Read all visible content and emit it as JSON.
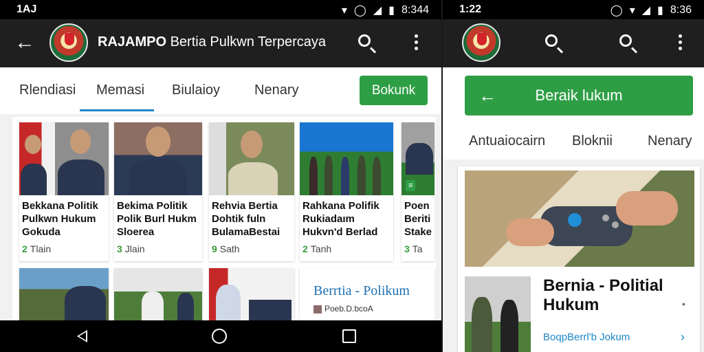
{
  "left": {
    "status": {
      "time": "1AJ",
      "clock": "8:344"
    },
    "appbar": {
      "title_bold": "RAJAMPO",
      "title_rest": " Bertia Pulkwn Terpercaya"
    },
    "tabs": [
      "Rlendiasi",
      "Memasi",
      "Biulaioy",
      "Nenary"
    ],
    "active_tab": 1,
    "action_button": "Bokunk",
    "cards": [
      {
        "headline": "Bekkana Politik Pulkwn Hukum Gokuda",
        "meta": "Tlain",
        "meta_icon": "2"
      },
      {
        "headline": "Bekima Politik Polik Burl Hukm Sloerea",
        "meta": "Jlain",
        "meta_icon": "3"
      },
      {
        "headline": "Rehvia Bertia Dohtik fuln BulamaBestai",
        "meta": "Sath",
        "meta_icon": "9"
      },
      {
        "headline": "Rahkana Polifik Rukiadaım Hukvn'd Berlad",
        "meta": "Tanh",
        "meta_icon": "2"
      },
      {
        "headline": "Poen Beriti Stake",
        "meta": "Ta",
        "meta_icon": "3"
      }
    ],
    "feature": {
      "title": "Berrtia - Polikum",
      "sub": "Poeb.D.bcoA"
    }
  },
  "right": {
    "status": {
      "time": "1:22",
      "clock": "8:36"
    },
    "green_bar": "Beraik lukum",
    "tabs": [
      "Antuaiocairn",
      "Bloknii",
      "Nenary"
    ],
    "feature": {
      "title": "Bernia - Politial Hukum",
      "link": "BoqpBerrl'b Jokum"
    }
  },
  "colors": {
    "accent_green": "#2e9e45",
    "tab_blue": "#1e88c8",
    "appbar": "#1f1f1f"
  },
  "icons": [
    "back-arrow-icon",
    "search-icon",
    "more-vert-icon",
    "wifi-icon",
    "battery-icon",
    "nav-back-icon",
    "nav-home-icon",
    "nav-recent-icon"
  ]
}
